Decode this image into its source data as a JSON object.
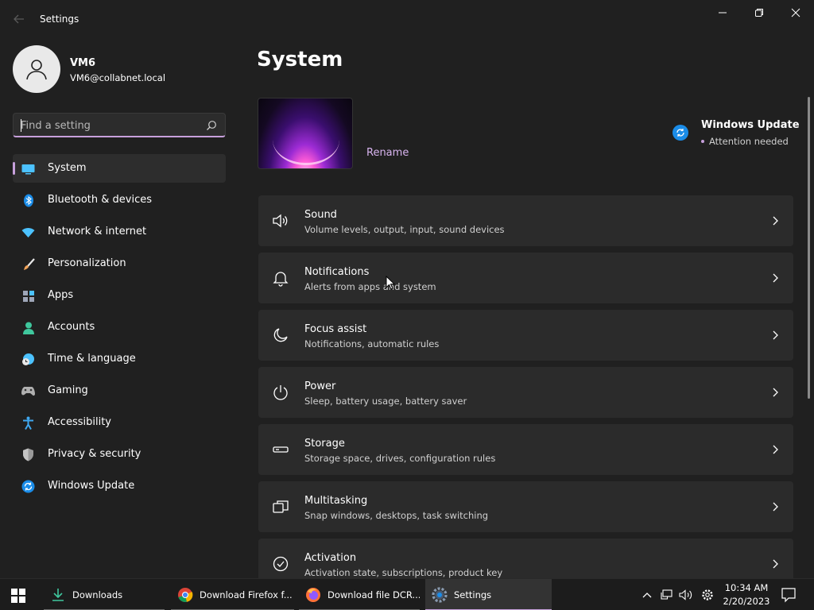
{
  "window": {
    "app_title": "Settings"
  },
  "profile": {
    "name": "VM6",
    "email": "VM6@collabnet.local"
  },
  "search": {
    "placeholder": "Find a setting"
  },
  "sidebar": {
    "items": [
      {
        "label": "System",
        "icon": "system-icon",
        "color": "#4cc2ff"
      },
      {
        "label": "Bluetooth & devices",
        "icon": "bluetooth-icon",
        "color": "#1a8ce8"
      },
      {
        "label": "Network & internet",
        "icon": "wifi-icon",
        "color": "#4cc2ff"
      },
      {
        "label": "Personalization",
        "icon": "brush-icon",
        "color": "#f0a35a"
      },
      {
        "label": "Apps",
        "icon": "apps-icon",
        "color": "#9ea6b8"
      },
      {
        "label": "Accounts",
        "icon": "accounts-icon",
        "color": "#3fc79d"
      },
      {
        "label": "Time & language",
        "icon": "clock-globe-icon",
        "color": "#4cc2ff"
      },
      {
        "label": "Gaming",
        "icon": "gamepad-icon",
        "color": "#b0b0b0"
      },
      {
        "label": "Accessibility",
        "icon": "accessibility-icon",
        "color": "#3fa8f0"
      },
      {
        "label": "Privacy & security",
        "icon": "shield-icon",
        "color": "#9a9a9a"
      },
      {
        "label": "Windows Update",
        "icon": "update-icon",
        "color": "#1a8ce8"
      }
    ]
  },
  "main": {
    "title": "System",
    "rename_label": "Rename",
    "windows_update": {
      "title": "Windows Update",
      "status": "Attention needed"
    },
    "cards": [
      {
        "title": "Sound",
        "subtitle": "Volume levels, output, input, sound devices",
        "icon": "speaker-icon"
      },
      {
        "title": "Notifications",
        "subtitle": "Alerts from apps and system",
        "icon": "bell-icon"
      },
      {
        "title": "Focus assist",
        "subtitle": "Notifications, automatic rules",
        "icon": "moon-icon"
      },
      {
        "title": "Power",
        "subtitle": "Sleep, battery usage, battery saver",
        "icon": "power-icon"
      },
      {
        "title": "Storage",
        "subtitle": "Storage space, drives, configuration rules",
        "icon": "storage-icon"
      },
      {
        "title": "Multitasking",
        "subtitle": "Snap windows, desktops, task switching",
        "icon": "multitasking-icon"
      },
      {
        "title": "Activation",
        "subtitle": "Activation state, subscriptions, product key",
        "icon": "check-circle-icon"
      }
    ]
  },
  "taskbar": {
    "items": [
      {
        "label": "Downloads",
        "icon": "download-icon"
      },
      {
        "label": "Download Firefox f...",
        "icon": "chrome-icon"
      },
      {
        "label": "Download file DCR...",
        "icon": "firefox-icon"
      },
      {
        "label": "Settings",
        "icon": "settings-gear-icon"
      }
    ],
    "clock": {
      "time": "10:34 AM",
      "date": "2/20/2023"
    }
  },
  "colors": {
    "accent": "#c7a0dc",
    "background": "#202020",
    "card": "#2b2b2b"
  }
}
